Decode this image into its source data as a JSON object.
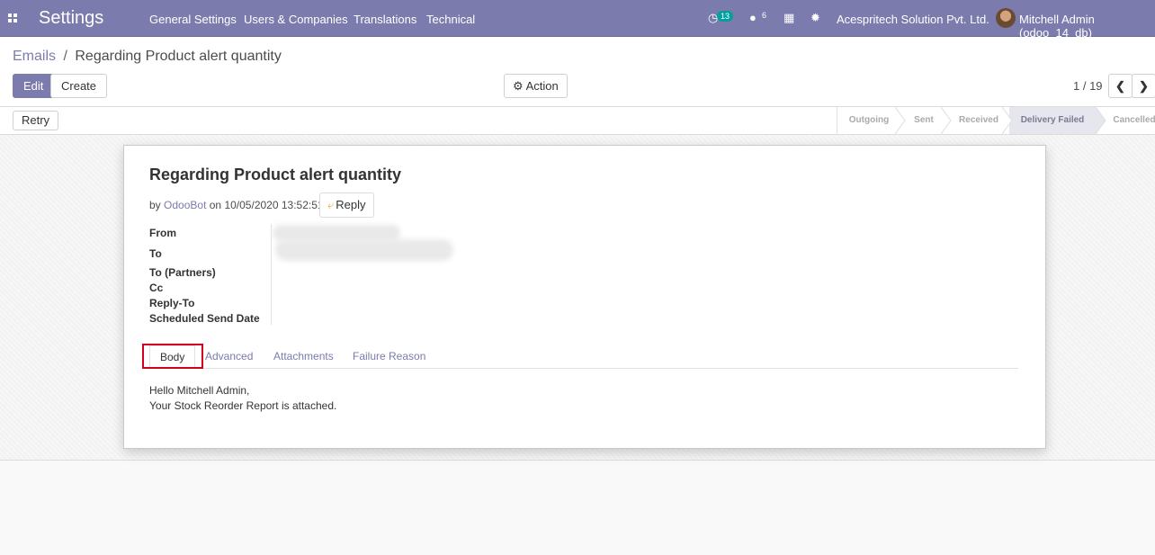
{
  "navbar": {
    "brand": "Settings",
    "menu": [
      "General Settings",
      "Users & Companies",
      "Translations",
      "Technical"
    ],
    "activity_count": "13",
    "messages_count": "6",
    "company": "Acespritech Solution Pvt. Ltd.",
    "user": "Mitchell Admin (odoo_14_db)"
  },
  "breadcrumb": {
    "parent": "Emails",
    "separator": "/",
    "current": "Regarding Product alert quantity"
  },
  "toolbar": {
    "edit_label": "Edit",
    "create_label": "Create",
    "action_label": "Action",
    "pager": "1 / 19"
  },
  "statusbar": {
    "retry_label": "Retry",
    "stages": [
      "Outgoing",
      "Sent",
      "Received",
      "Delivery Failed",
      "Cancelled"
    ],
    "active_stage": "Delivery Failed"
  },
  "mail": {
    "subject": "Regarding Product alert quantity",
    "by_prefix": "by",
    "author": "OdooBot",
    "date_prefix": "on",
    "date": "10/05/2020 13:52:51",
    "reply_label": "Reply",
    "fields": [
      "From",
      "To",
      "To (Partners)",
      "Cc",
      "Reply-To",
      "Scheduled Send Date"
    ]
  },
  "tabs": [
    "Body",
    "Advanced",
    "Attachments",
    "Failure Reason"
  ],
  "body_lines": [
    "Hello Mitchell Admin,",
    "Your Stock Reorder Report is attached."
  ],
  "colors": {
    "brand": "#7c7bad",
    "badge": "#00a09d",
    "highlight": "#d0021b"
  }
}
